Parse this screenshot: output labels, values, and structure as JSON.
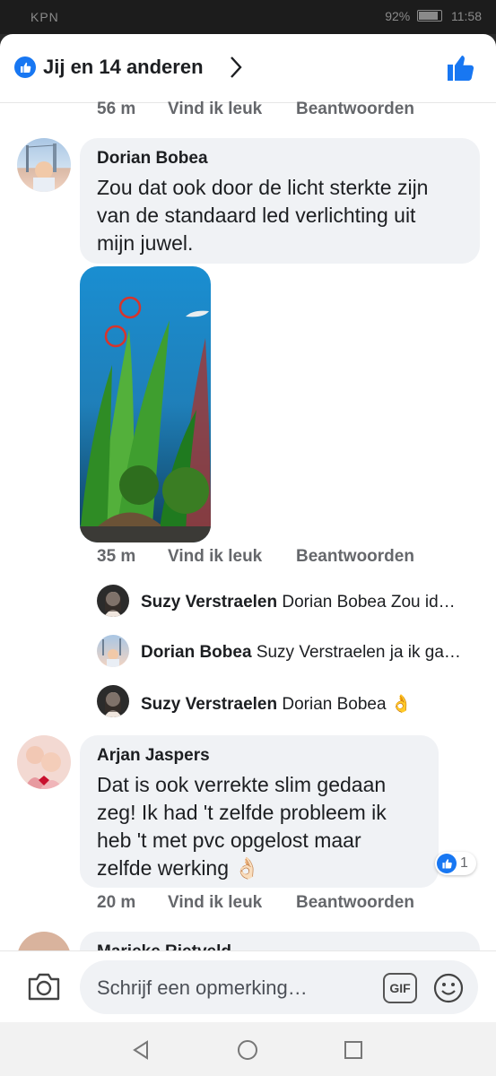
{
  "status_bar": {
    "carrier": "KPN",
    "battery": "92%",
    "time": "11:58"
  },
  "header": {
    "likes_text": "Jij en 14 anderen"
  },
  "top_meta": {
    "time": "56 m",
    "like": "Vind ik leuk",
    "reply": "Beantwoorden"
  },
  "comments": [
    {
      "author": "Dorian Bobea",
      "lines": [
        "Zou dat ook door de licht sterkte zijn",
        "van de standaard led verlichting uit",
        "mijn juwel."
      ],
      "time": "35 m",
      "like": "Vind ik leuk",
      "reply": "Beantwoorden"
    },
    {
      "author": "Arjan Jaspers",
      "lines": [
        "Dat is ook verrekte slim gedaan",
        "zeg! Ik had 't zelfde probleem ik",
        "heb 't met pvc opgelost maar",
        "zelfde werking 👌🏻"
      ],
      "time": "20 m",
      "like": "Vind ik leuk",
      "reply": "Beantwoorden",
      "reaction_count": "1"
    },
    {
      "author_partial": "Marieke Rietveld"
    }
  ],
  "replies": [
    {
      "author": "Suzy Verstraelen",
      "text": "Dorian Bobea Zou id…"
    },
    {
      "author": "Dorian Bobea",
      "text": "Suzy Verstraelen ja ik ga…"
    },
    {
      "author": "Suzy Verstraelen",
      "text": "Dorian Bobea 👌"
    }
  ],
  "composer": {
    "placeholder": "Schrijf een opmerking…",
    "gif_label": "GIF"
  },
  "colors": {
    "accent": "#1877f2",
    "bubble": "#f0f2f5",
    "meta": "#65676b"
  }
}
